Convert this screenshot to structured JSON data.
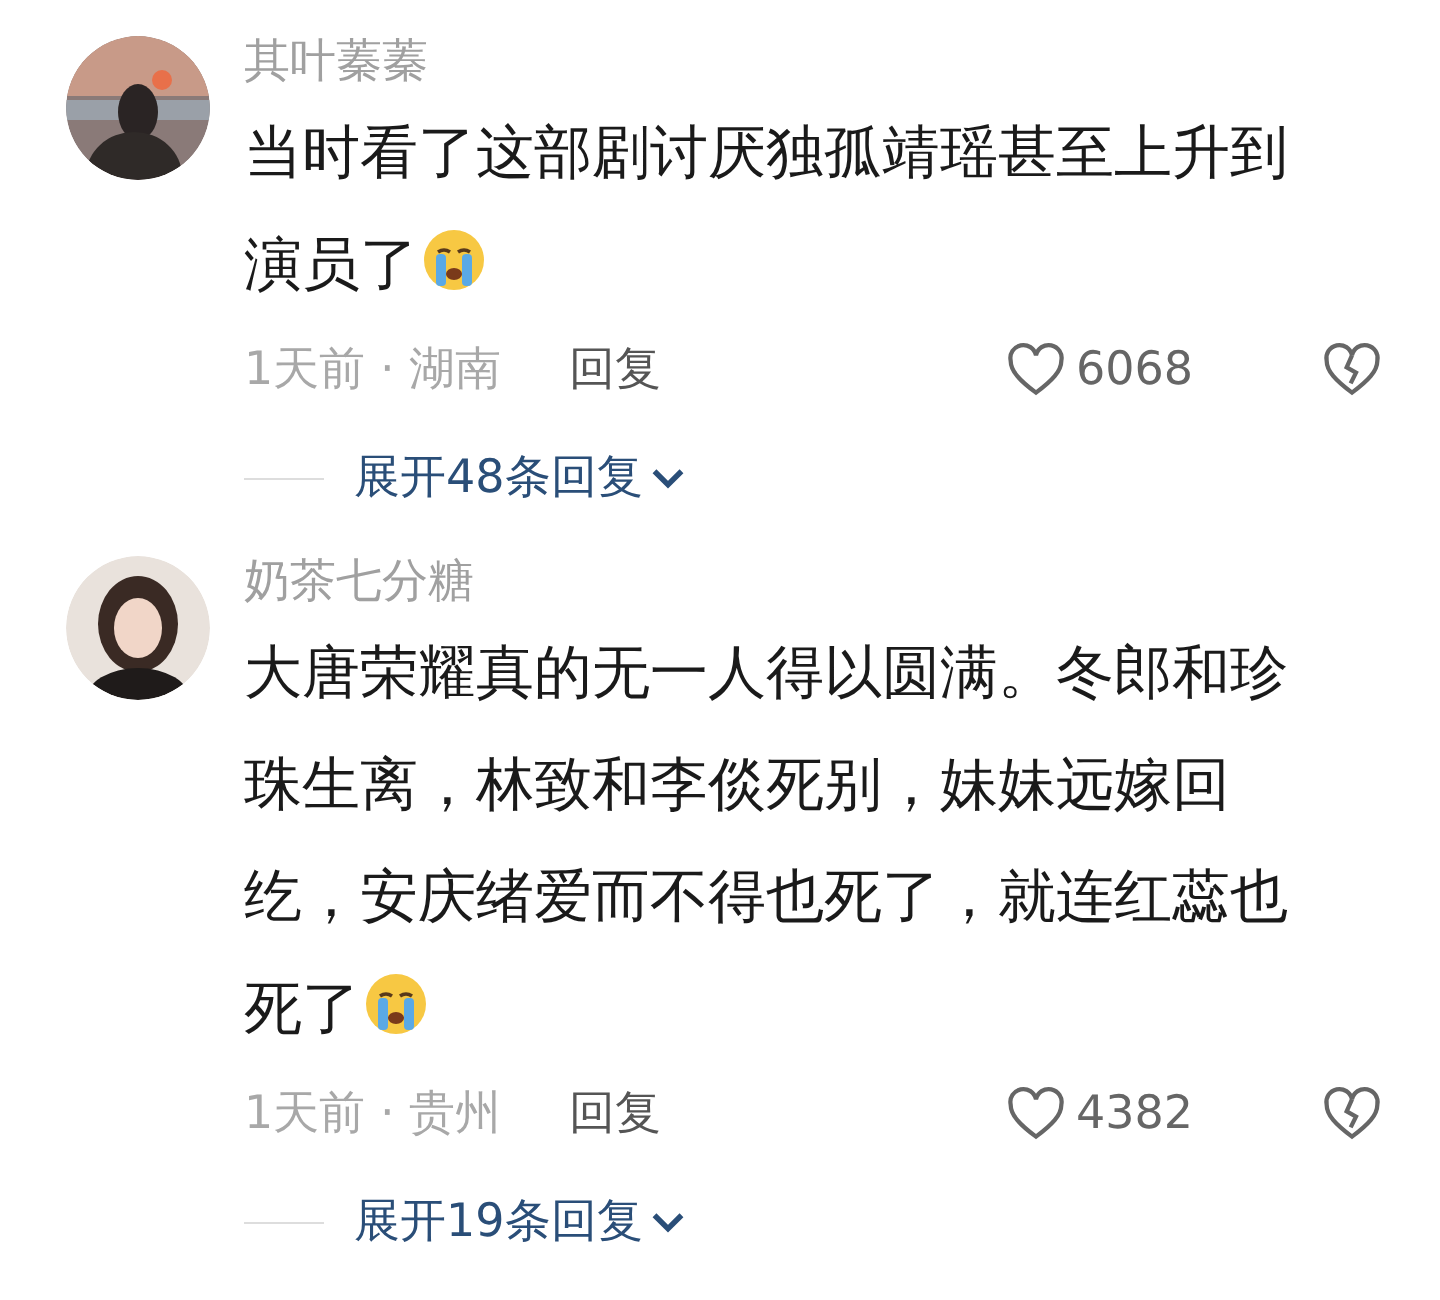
{
  "comments": [
    {
      "username": "其叶蓁蓁",
      "text": "当时看了这部剧讨厌独孤靖瑶甚至上升到演员了",
      "emoji": true,
      "time_location": "1天前 · 湖南",
      "reply": "回复",
      "likes": "6068",
      "expand": "展开48条回复"
    },
    {
      "username": "奶茶七分糖",
      "text": "大唐荣耀真的无一人得以圆满。冬郎和珍珠生离，林致和李倓死别，妹妹远嫁回纥，安庆绪爱而不得也死了，就连红蕊也死了",
      "emoji": true,
      "time_location": "1天前 · 贵州",
      "reply": "回复",
      "likes": "4382",
      "expand": "展开19条回复"
    }
  ]
}
